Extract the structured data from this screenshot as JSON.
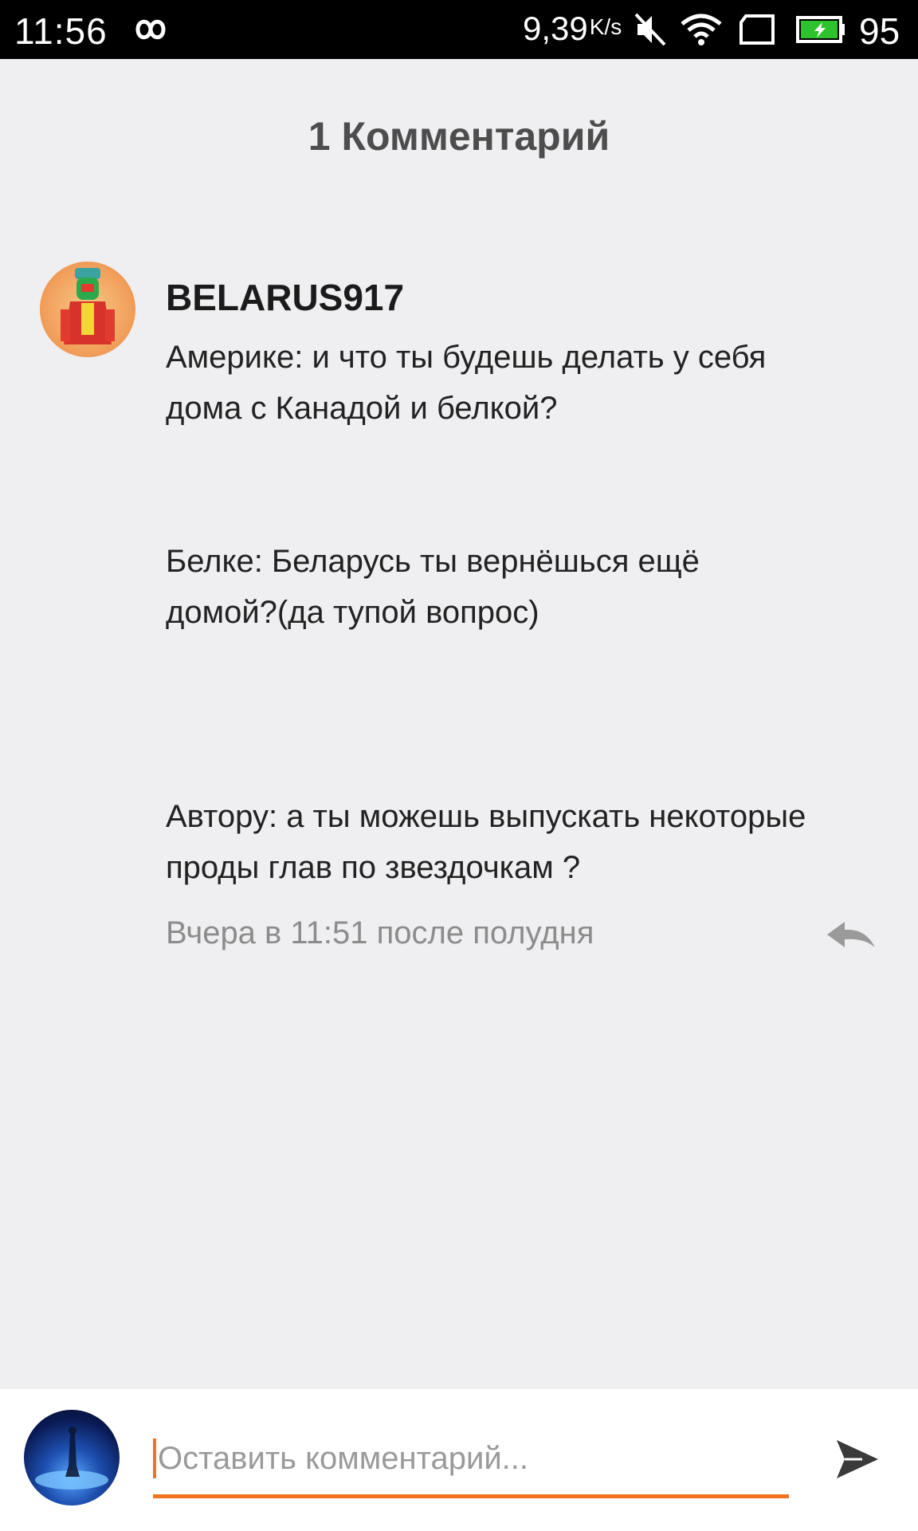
{
  "status_bar": {
    "time": "11:56",
    "speed": "9,39",
    "speed_unit": "K/s",
    "battery": "95",
    "icons": [
      "infinity-icon",
      "mute-icon",
      "wifi-icon",
      "sim-icon",
      "battery-charging-icon"
    ],
    "battery_color": "#2fc22f"
  },
  "header": {
    "title": "1 Комментарий"
  },
  "comment": {
    "avatar_icon": "user-avatar",
    "username": "BELARUS917",
    "lines": [
      "Америке: и что ты будешь делать у себя",
      "дома с Канадой и белкой?",
      "Белке: Беларусь ты вернёшься ещё",
      "домой?(да тупой вопрос)",
      "Автору: а ты можешь выпускать некоторые",
      "проды глав по звездочкам ?"
    ],
    "timestamp": "Вчера в 11:51 после полудня",
    "reply_icon": "reply-icon"
  },
  "composer": {
    "placeholder": "Оставить комментарий...",
    "accent_color": "#f07420",
    "send_icon": "send-icon"
  }
}
